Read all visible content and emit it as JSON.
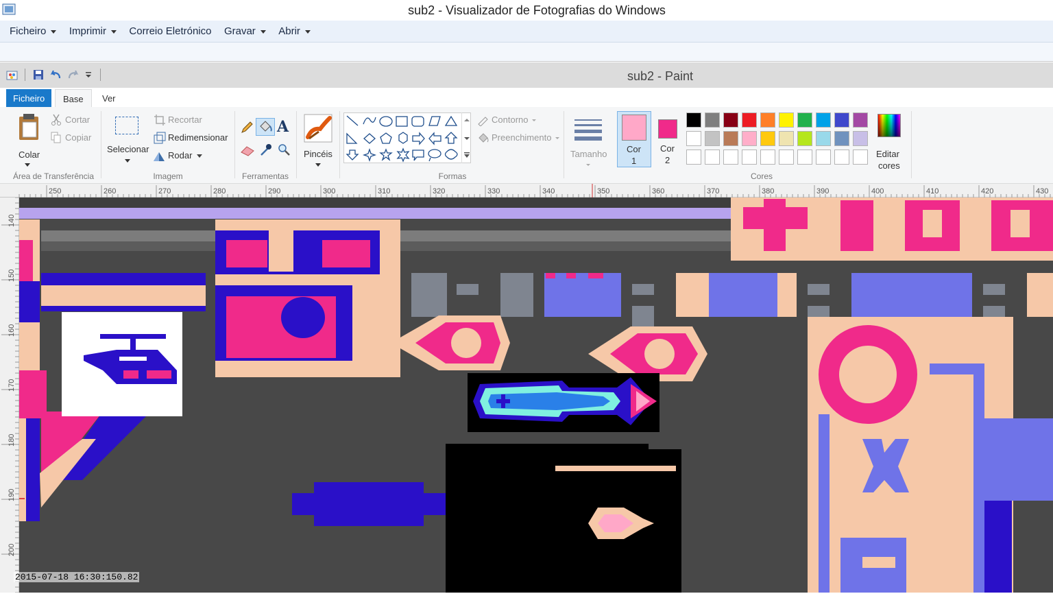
{
  "viewer": {
    "title": "sub2 - Visualizador de Fotografias do Windows",
    "menu": [
      "Ficheiro",
      "Imprimir",
      "Correio Eletrónico",
      "Gravar",
      "Abrir"
    ]
  },
  "paint": {
    "title": "sub2 - Paint",
    "tabs": {
      "file": "Ficheiro",
      "home": "Base",
      "view": "Ver"
    },
    "clipboard": {
      "paste": "Colar",
      "cut": "Cortar",
      "copy": "Copiar",
      "label": "Área de Transferência"
    },
    "image": {
      "select": "Selecionar",
      "crop": "Recortar",
      "resize": "Redimensionar",
      "rotate": "Rodar",
      "label": "Imagem"
    },
    "tools": {
      "label": "Ferramentas"
    },
    "brushes": {
      "label": "Pincéis"
    },
    "shapes": {
      "outline": "Contorno",
      "fill": "Preenchimento",
      "label": "Formas"
    },
    "size": {
      "label": "Tamanho"
    },
    "color1": {
      "label": "Cor",
      "num": "1",
      "value": "#ffa8c8"
    },
    "color2": {
      "label": "Cor",
      "num": "2",
      "value": "#f02a8a"
    },
    "colors": {
      "label": "Cores",
      "edit": "Editar",
      "edit2": "cores",
      "row1": [
        "#000000",
        "#7f7f7f",
        "#880015",
        "#ed1c24",
        "#ff7f27",
        "#fff200",
        "#22b14c",
        "#00a2e8",
        "#3f48cc",
        "#a349a4"
      ],
      "row2": [
        "#ffffff",
        "#c3c3c3",
        "#b97a57",
        "#ffaec9",
        "#ffc90e",
        "#efe4b0",
        "#b5e61d",
        "#99d9ea",
        "#7092be",
        "#c8bfe7"
      ]
    },
    "ruler_x": [
      "250",
      "260",
      "270",
      "280",
      "290",
      "300",
      "310",
      "320",
      "330",
      "340",
      "350",
      "360",
      "370",
      "380",
      "390",
      "400",
      "410",
      "420",
      "430"
    ],
    "ruler_y": [
      "140",
      "150",
      "160",
      "170",
      "180",
      "190",
      "200"
    ]
  },
  "timestamp": "2015-07-18 16:30:150.82"
}
